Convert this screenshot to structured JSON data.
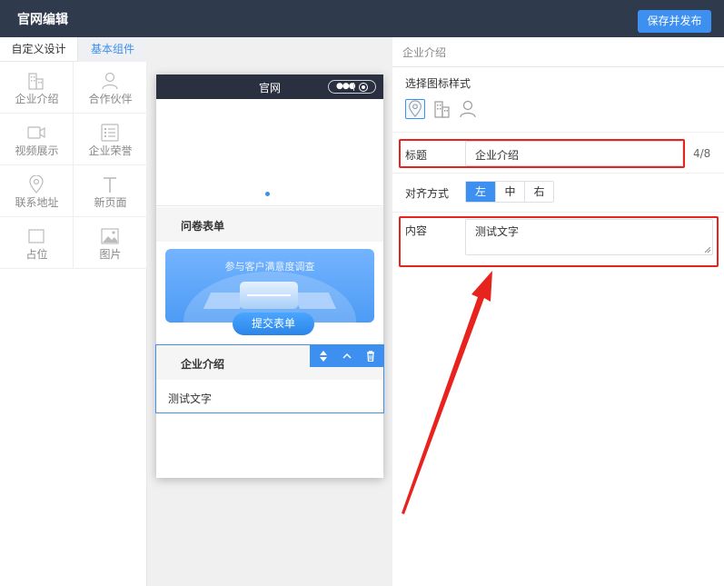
{
  "app": {
    "title": "官网编辑",
    "publish_label": "保存并发布"
  },
  "left_panel": {
    "tabs": [
      {
        "label": "自定义设计",
        "active": false
      },
      {
        "label": "基本组件",
        "active": true
      }
    ],
    "components": [
      {
        "label": "企业介绍",
        "icon": "building-icon"
      },
      {
        "label": "合作伙伴",
        "icon": "person-icon"
      },
      {
        "label": "视频展示",
        "icon": "video-icon"
      },
      {
        "label": "企业荣誉",
        "icon": "list-icon"
      },
      {
        "label": "联系地址",
        "icon": "location-pin-icon"
      },
      {
        "label": "新页面",
        "icon": "text-t-icon"
      },
      {
        "label": "占位",
        "icon": "placeholder-square-icon"
      },
      {
        "label": "图片",
        "icon": "image-icon"
      }
    ]
  },
  "phone": {
    "title": "官网",
    "section_survey": {
      "title": "问卷表单",
      "banner_text": "参与客户满意度调查",
      "submit_label": "提交表单"
    },
    "section_intro": {
      "title": "企业介绍",
      "content": "测试文字"
    }
  },
  "right_panel": {
    "header": "企业介绍",
    "icon_style_label": "选择图标样式",
    "icon_styles": [
      "location-pin-icon",
      "building-icon",
      "person-icon"
    ],
    "title_label": "标题",
    "title_value": "企业介绍",
    "title_count": "4/8",
    "align_label": "对齐方式",
    "align_options": [
      "左",
      "中",
      "右"
    ],
    "align_selected": "左",
    "content_label": "内容",
    "content_value": "测试文字"
  },
  "colors": {
    "accent": "#3d8ff0",
    "topbar": "#2f3a4d",
    "annotation_red": "#e8221c"
  }
}
